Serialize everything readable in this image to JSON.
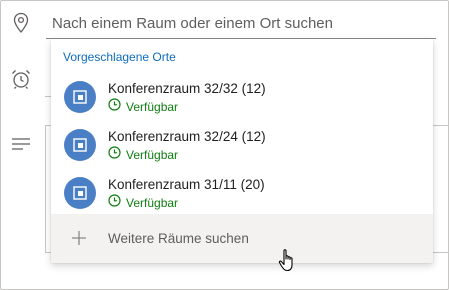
{
  "search": {
    "placeholder": "Nach einem Raum oder einem Ort suchen",
    "value": ""
  },
  "suggestions": {
    "header": "Vorgeschlagene Orte",
    "rooms": [
      {
        "name": "Konferenzraum 32/32 (12)",
        "status": "Verfügbar",
        "icon": "room-icon"
      },
      {
        "name": "Konferenzraum 32/24 (12)",
        "status": "Verfügbar",
        "icon": "room-icon"
      },
      {
        "name": "Konferenzraum 31/11 (20)",
        "status": "Verfügbar",
        "icon": "room-icon"
      }
    ],
    "more_label": "Weitere Räume suchen"
  },
  "colors": {
    "accent": "#0f6cbd",
    "available": "#107c10",
    "avatar": "#4a7fc6",
    "hover": "#f3f2f1"
  }
}
